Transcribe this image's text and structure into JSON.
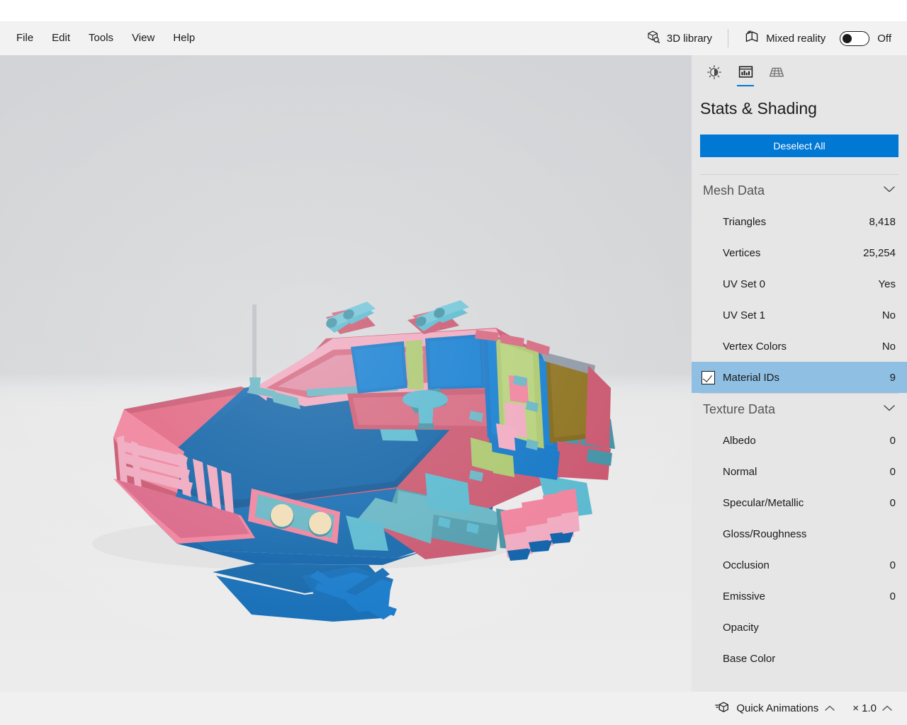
{
  "app": {
    "title_bar": ""
  },
  "menubar": {
    "items": [
      {
        "label": "File",
        "name": "menu-file"
      },
      {
        "label": "Edit",
        "name": "menu-edit"
      },
      {
        "label": "Tools",
        "name": "menu-tools"
      },
      {
        "label": "View",
        "name": "menu-view"
      },
      {
        "label": "Help",
        "name": "menu-help"
      }
    ],
    "library_label": "3D library",
    "library_icon": "cube-search-icon",
    "mixed_reality_label": "Mixed reality",
    "mixed_reality_icon": "mixed-reality-icon",
    "mixed_reality_state": "Off",
    "mixed_reality_toggle_on": false
  },
  "panel": {
    "tabs": [
      {
        "name": "tab-lighting",
        "icon": "sun-icon",
        "active": false
      },
      {
        "name": "tab-stats-shading",
        "icon": "bar-chart-icon",
        "active": true
      },
      {
        "name": "tab-grid",
        "icon": "perspective-grid-icon",
        "active": false
      }
    ],
    "title": "Stats & Shading",
    "deselect_label": "Deselect All",
    "accent_color": "#0078d4",
    "selection_color": "#8fbfe3",
    "background_color": "#e6e6e6",
    "groups": [
      {
        "name": "mesh-data",
        "header": "Mesh Data",
        "expanded": true,
        "chevron": "chevron-down-icon",
        "rows": [
          {
            "label": "Triangles",
            "value": "8,418",
            "selected": false,
            "checkbox": false
          },
          {
            "label": "Vertices",
            "value": "25,254",
            "selected": false,
            "checkbox": false
          },
          {
            "label": "UV Set 0",
            "value": "Yes",
            "selected": false,
            "checkbox": false
          },
          {
            "label": "UV Set 1",
            "value": "No",
            "selected": false,
            "checkbox": false
          },
          {
            "label": "Vertex Colors",
            "value": "No",
            "selected": false,
            "checkbox": false
          },
          {
            "label": "Material IDs",
            "value": "9",
            "selected": true,
            "checkbox": true,
            "checked": true
          }
        ]
      },
      {
        "name": "texture-data",
        "header": "Texture Data",
        "expanded": true,
        "chevron": "chevron-down-icon",
        "rows": [
          {
            "label": "Albedo",
            "value": "0",
            "selected": false,
            "checkbox": false
          },
          {
            "label": "Normal",
            "value": "0",
            "selected": false,
            "checkbox": false
          },
          {
            "label": "Specular/Metallic",
            "value": "0",
            "selected": false,
            "checkbox": false
          },
          {
            "label": "Gloss/Roughness",
            "value": "",
            "selected": false,
            "checkbox": false
          },
          {
            "label": "Occlusion",
            "value": "0",
            "selected": false,
            "checkbox": false
          },
          {
            "label": "Emissive",
            "value": "0",
            "selected": false,
            "checkbox": false
          },
          {
            "label": "Opacity",
            "value": "",
            "selected": false,
            "checkbox": false
          },
          {
            "label": "Base Color",
            "value": "",
            "selected": false,
            "checkbox": false
          }
        ]
      }
    ]
  },
  "statusbar": {
    "quick_animations_label": "Quick Animations",
    "quick_animations_icon": "animated-cube-icon",
    "quick_animations_chevron": "chevron-up-icon",
    "speed_label": "× 1.0",
    "speed_chevron": "chevron-up-icon"
  },
  "viewport": {
    "name": "3d-viewport",
    "scene": "low-poly armored vehicle",
    "background_top_color": "#d2d4d7",
    "background_bottom_color": "#ececec",
    "model_colors": {
      "body_rose": "#c8526b",
      "body_pink": "#ef7f9a",
      "body_pink_light": "#f0a8bf",
      "blue_dark": "#0a5ea8",
      "blue_mid": "#0c72c4",
      "blue_light": "#1a86d8",
      "cyan": "#55b7ce",
      "cyan_dark": "#3d8fa3",
      "teal": "#3f8fa0",
      "green": "#a9c66a",
      "olive": "#7d6312",
      "cream": "#f0dcb4",
      "gray_panel": "#8d96a5"
    }
  }
}
